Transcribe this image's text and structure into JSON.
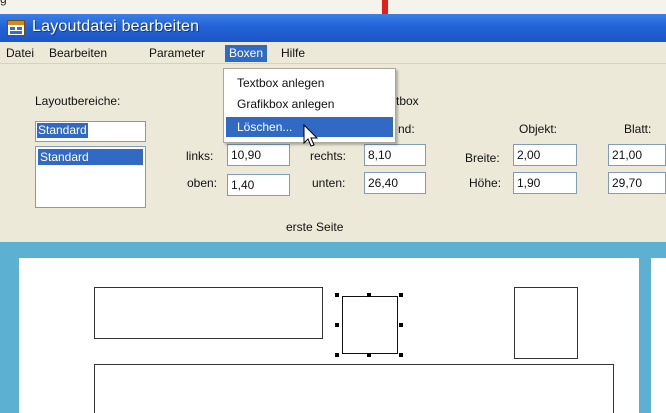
{
  "window": {
    "title": "Layoutdatei bearbeiten",
    "top_cut_text": "g"
  },
  "menu": {
    "items": [
      "Datei",
      "Bearbeiten",
      "Parameter",
      "Boxen",
      "Hilfe"
    ],
    "active": "Boxen"
  },
  "dropdown": {
    "items": [
      "Textbox anlegen",
      "Grafikbox anlegen",
      "Löschen..."
    ],
    "highlighted": "Löschen..."
  },
  "panel": {
    "layout_areas_label": "Layoutbereiche:",
    "layout_name_value": "Standard",
    "layout_list": [
      "Standard"
    ],
    "partial_group_label": "tbox",
    "partial_rand_label": "nd:",
    "object_label": "Objekt:",
    "sheet_label": "Blatt:",
    "left_label": "links:",
    "left_value": "10,90",
    "right_label": "rechts:",
    "right_value": "8,10",
    "width_label": "Breite:",
    "width_value": "2,00",
    "sheet_width_value": "21,00",
    "top_label": "oben:",
    "top_value": "1,40",
    "bottom_label": "unten:",
    "bottom_value": "26,40",
    "height_label": "Höhe:",
    "height_value": "1,90",
    "sheet_height_value": "29,70",
    "page_label": "erste Seite"
  },
  "colors": {
    "titlebar": "#2363d6",
    "selection": "#316ac5",
    "canvas_background": "#5cb1d3",
    "annotation_arrow": "#e0201a"
  },
  "icons": {
    "app_icon": "layout-file-icon",
    "pointer": "mouse-cursor-icon",
    "annotation": "red-arrow-icon"
  }
}
